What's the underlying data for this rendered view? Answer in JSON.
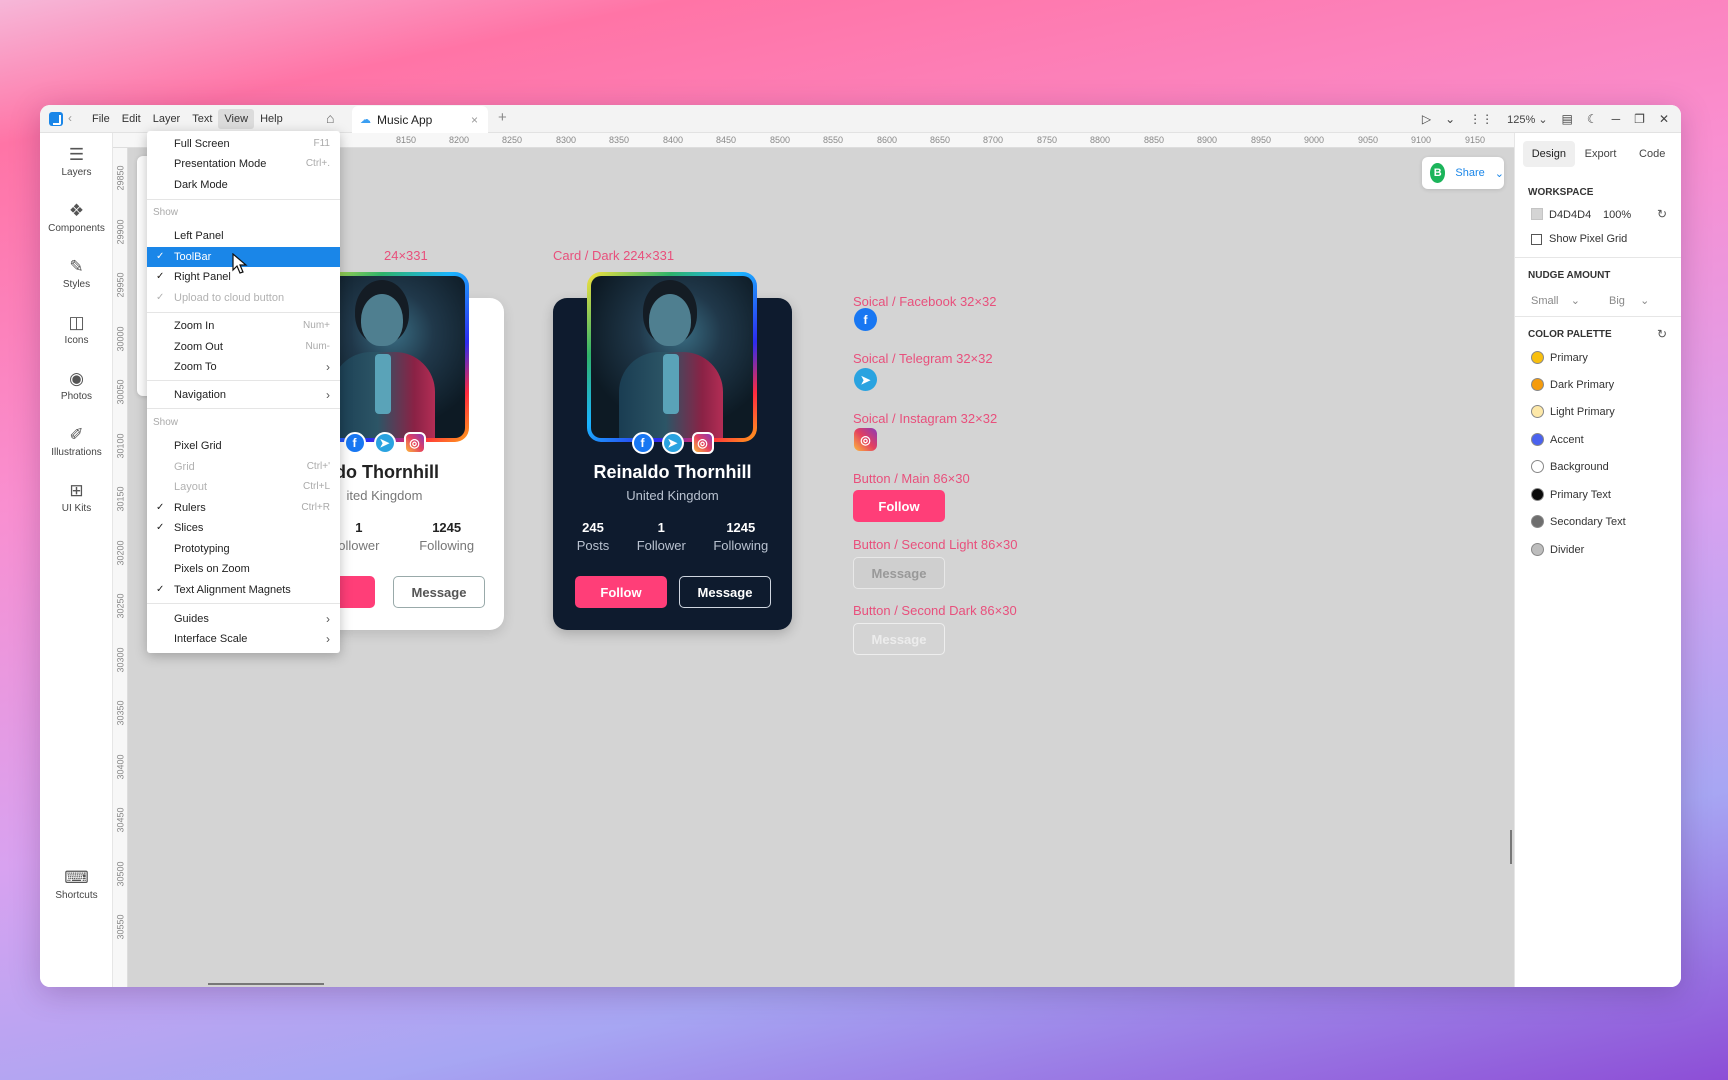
{
  "window": {
    "menu": [
      "File",
      "Edit",
      "Layer",
      "Text",
      "View",
      "Help"
    ],
    "active_menu": "View",
    "tab_label": "Music App",
    "zoom": "125%",
    "back_glyph": "‹",
    "tab_close": "×",
    "tab_add": "+"
  },
  "leftbar": {
    "items": [
      {
        "label": "Layers",
        "icon": "layers-icon"
      },
      {
        "label": "Components",
        "icon": "components-icon"
      },
      {
        "label": "Styles",
        "icon": "styles-icon"
      },
      {
        "label": "Icons",
        "icon": "icons-icon"
      },
      {
        "label": "Photos",
        "icon": "camera-icon"
      },
      {
        "label": "Illustrations",
        "icon": "illustrations-icon"
      },
      {
        "label": "UI Kits",
        "icon": "ui-kits-icon"
      }
    ],
    "shortcuts_label": "Shortcuts"
  },
  "rulers": {
    "h_ticks": [
      "8150",
      "8200",
      "8250",
      "8300",
      "8350",
      "8400",
      "8450",
      "8500",
      "8550",
      "8600",
      "8650",
      "8700",
      "8750",
      "8800",
      "8850",
      "8900",
      "8950",
      "9000",
      "9050",
      "9100",
      "9150"
    ],
    "v_ticks": [
      "29850",
      "29900",
      "29950",
      "30000",
      "30050",
      "30100",
      "30150",
      "30200",
      "30250",
      "30300",
      "30350",
      "30400",
      "30450",
      "30500",
      "30550"
    ]
  },
  "share": {
    "label": "Share",
    "avatar": "B"
  },
  "canvas": {
    "light_card_label": "24×331",
    "dark_card_label": "Card / Dark   224×331",
    "light_card": {
      "name": "ldo Thornhill",
      "location": "ited Kingdom",
      "stats": [
        {
          "num": "1",
          "label": "ollower"
        },
        {
          "num": "1245",
          "label": "Following"
        }
      ],
      "message": "Message"
    },
    "dark_card": {
      "name": "Reinaldo Thornhill",
      "location": "United Kingdom",
      "stats": [
        {
          "num": "245",
          "label": "Posts"
        },
        {
          "num": "1",
          "label": "Follower"
        },
        {
          "num": "1245",
          "label": "Following"
        }
      ],
      "follow": "Follow",
      "message": "Message"
    },
    "components": [
      {
        "label": "Soical / Facebook   32×32"
      },
      {
        "label": "Soical / Telegram   32×32"
      },
      {
        "label": "Soical / Instagram   32×32"
      },
      {
        "label": "Button / Main 86×30",
        "button": "Follow"
      },
      {
        "label": "Button / Second Light 86×30",
        "button": "Message"
      },
      {
        "label": "Button / Second Dark  86×30",
        "button": "Message"
      }
    ]
  },
  "view_menu": {
    "items_top": [
      {
        "label": "Full Screen",
        "shortcut": "F11"
      },
      {
        "label": "Presentation Mode",
        "shortcut": "Ctrl+."
      },
      {
        "label": "Dark Mode",
        "shortcut": ""
      }
    ],
    "show_label_1": "Show",
    "show_items_1": [
      {
        "label": "Left Panel",
        "checked": false
      },
      {
        "label": "ToolBar",
        "checked": true,
        "highlighted": true
      },
      {
        "label": "Right Panel",
        "checked": true
      },
      {
        "label": "Upload to cloud button",
        "checked": true,
        "disabled": true
      }
    ],
    "zoom_items": [
      {
        "label": "Zoom In",
        "shortcut": "Num+"
      },
      {
        "label": "Zoom Out",
        "shortcut": "Num-"
      },
      {
        "label": "Zoom To",
        "submenu": true
      }
    ],
    "navigation": "Navigation",
    "show_label_2": "Show",
    "show_items_2": [
      {
        "label": "Pixel Grid",
        "checked": false
      },
      {
        "label": "Grid",
        "shortcut": "Ctrl+'",
        "disabled": true
      },
      {
        "label": "Layout",
        "shortcut": "Ctrl+L",
        "disabled": true
      },
      {
        "label": "Rulers",
        "shortcut": "Ctrl+R",
        "checked": true
      },
      {
        "label": "Slices",
        "checked": true
      },
      {
        "label": "Prototyping",
        "checked": false
      },
      {
        "label": "Pixels on Zoom",
        "checked": false
      },
      {
        "label": "Text Alignment Magnets",
        "checked": true
      }
    ],
    "guides": "Guides",
    "interface_scale": "Interface Scale",
    "check_glyph": "✓",
    "submenu_glyph": "›"
  },
  "right_panel": {
    "tabs": [
      "Design",
      "Export",
      "Code"
    ],
    "active_tab": "Design",
    "workspace_title": "WORKSPACE",
    "workspace_color": "D4D4D4",
    "workspace_opacity": "100%",
    "show_pixel_grid": "Show Pixel Grid",
    "nudge_title": "NUDGE AMOUNT",
    "nudge_small": "Small",
    "nudge_big": "Big",
    "palette_title": "COLOR PALETTE",
    "palette": [
      {
        "name": "Primary",
        "color": "#f8bf0e"
      },
      {
        "name": "Dark Primary",
        "color": "#f59b0c"
      },
      {
        "name": "Light Primary",
        "color": "#fde8a8"
      },
      {
        "name": "Accent",
        "color": "#4a62ee"
      },
      {
        "name": "Background",
        "color": "#ffffff"
      },
      {
        "name": "Primary Text",
        "color": "#0a0a0a"
      },
      {
        "name": "Secondary Text",
        "color": "#6e6e6e"
      },
      {
        "name": "Divider",
        "color": "#bdbdbd"
      }
    ]
  }
}
